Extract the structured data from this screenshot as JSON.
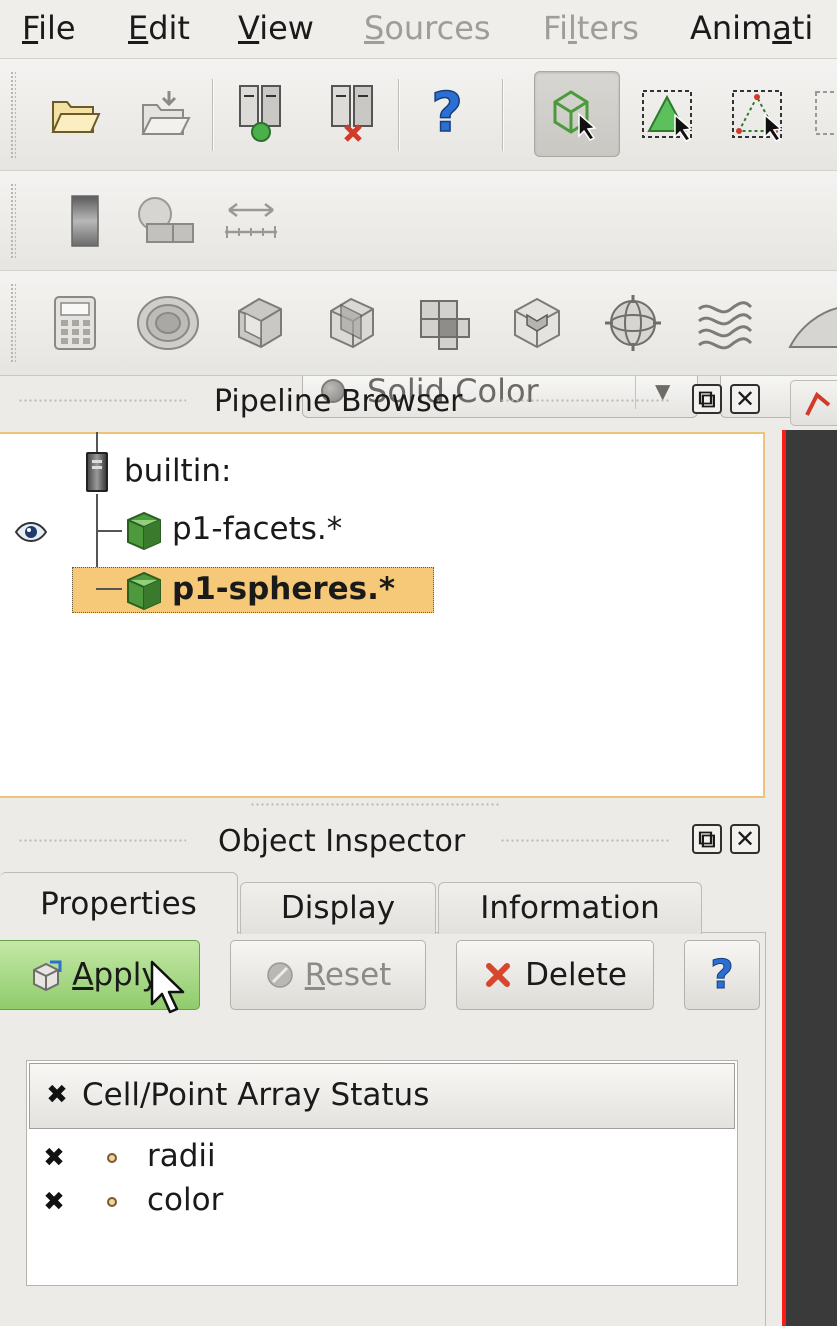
{
  "menubar": {
    "items": [
      {
        "label": "File",
        "mn": "F",
        "rest": "ile",
        "enabled": true
      },
      {
        "label": "Edit",
        "mn": "E",
        "rest": "dit",
        "enabled": true
      },
      {
        "label": "View",
        "mn": "V",
        "rest": "iew",
        "enabled": true
      },
      {
        "label": "Sources",
        "mn": "S",
        "rest": "ources",
        "enabled": false
      },
      {
        "label": "Filters",
        "pre": "Fi",
        "mn": "l",
        "rest": "ters",
        "enabled": false
      },
      {
        "label": "Animati",
        "pre": "Anim",
        "mn": "a",
        "rest": "ti",
        "enabled": true
      }
    ]
  },
  "toolbar_main": {
    "icons": [
      "open-folder-icon",
      "save-data-icon",
      "connect-server-icon",
      "disconnect-server-icon",
      "help-icon",
      "reset-camera-select-icon",
      "select-cells-icon",
      "select-points-icon"
    ]
  },
  "toolbar_display": {
    "color_by": "Solid Color"
  },
  "toolbar_filters": {
    "icons": [
      "calculator-icon",
      "contour-icon",
      "clip-icon",
      "slice-icon",
      "threshold-icon",
      "extract-subset-icon",
      "glyph-icon",
      "stream-tracer-icon"
    ]
  },
  "pipeline_browser": {
    "title": "Pipeline Browser",
    "root": "builtin:",
    "items": [
      {
        "label": "p1-facets.*",
        "visible": true,
        "selected": false
      },
      {
        "label": "p1-spheres.*",
        "visible": false,
        "selected": true
      }
    ]
  },
  "object_inspector": {
    "title": "Object Inspector",
    "tabs": [
      "Properties",
      "Display",
      "Information"
    ],
    "active_tab": "Properties",
    "apply_label": "Apply",
    "apply_mn": "A",
    "apply_rest": "pply",
    "reset_label": "Reset",
    "reset_mn": "R",
    "reset_rest": "eset",
    "delete_label": "Delete",
    "help_label": "?",
    "array_status": {
      "header": "Cell/Point Array Status",
      "rows": [
        {
          "name": "radii",
          "checked": true
        },
        {
          "name": "color",
          "checked": true
        }
      ]
    }
  },
  "dock_buttons": {
    "float": "⧉",
    "close": "✕"
  },
  "colors": {
    "accent": "#f6c978",
    "apply_green": "#8fcc6c",
    "render_border": "#ff1a1a"
  }
}
